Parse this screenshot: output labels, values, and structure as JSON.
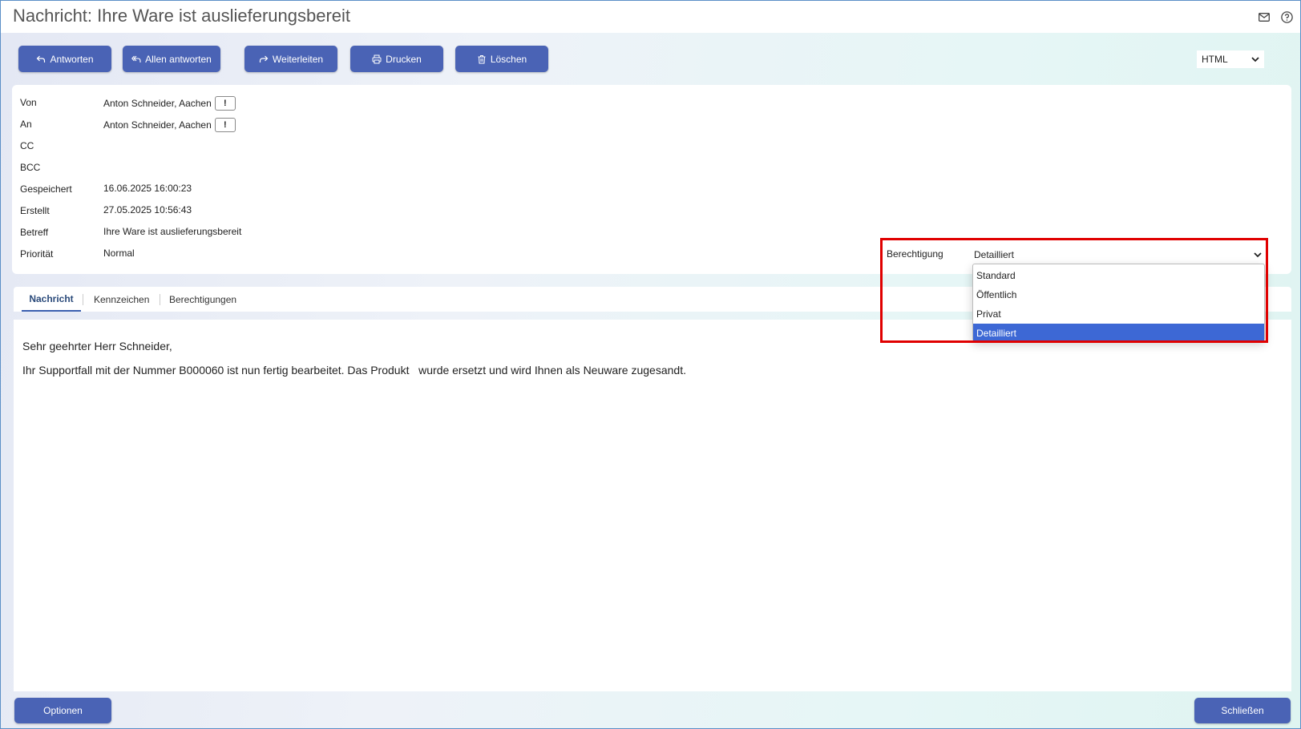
{
  "window": {
    "title": "Nachricht: Ihre Ware ist auslieferungsbereit"
  },
  "toolbar": {
    "reply_label": "Antworten",
    "reply_all_label": "Allen antworten",
    "forward_label": "Weiterleiten",
    "print_label": "Drucken",
    "delete_label": "Löschen"
  },
  "format": {
    "selected": "HTML"
  },
  "header": {
    "from_label": "Von",
    "from_value": "Anton Schneider, Aachen",
    "to_label": "An",
    "to_value": "Anton Schneider, Aachen",
    "cc_label": "CC",
    "bcc_label": "BCC",
    "saved_label": "Gespeichert",
    "saved_value": "16.06.2025 16:00:23",
    "created_label": "Erstellt",
    "created_value": "27.05.2025 10:56:43",
    "subject_label": "Betreff",
    "subject_value": "Ihre Ware ist auslieferungsbereit",
    "priority_label": "Priorität",
    "priority_value": "Normal",
    "excl_glyph": "!"
  },
  "permission": {
    "label": "Berechtigung",
    "selected": "Detailliert",
    "options": [
      "Standard",
      "Öffentlich",
      "Privat",
      "Detailliert"
    ]
  },
  "tabs": [
    "Nachricht",
    "Kennzeichen",
    "Berechtigungen"
  ],
  "message": {
    "greeting": "Sehr geehrter Herr Schneider,",
    "body": "Ihr Supportfall mit der Nummer B000060 ist nun fertig bearbeitet. Das Produkt   wurde ersetzt und wird Ihnen als Neuware zugesandt."
  },
  "footer": {
    "options_label": "Optionen",
    "close_label": "Schließen"
  },
  "colors": {
    "accent": "#4a63b5",
    "highlight": "#e00000",
    "selected_option": "#3d68d5"
  },
  "icons": [
    "mail-icon",
    "help-icon",
    "reply-icon",
    "reply-all-icon",
    "forward-icon",
    "printer-icon",
    "trash-icon",
    "chevron-down-icon"
  ]
}
